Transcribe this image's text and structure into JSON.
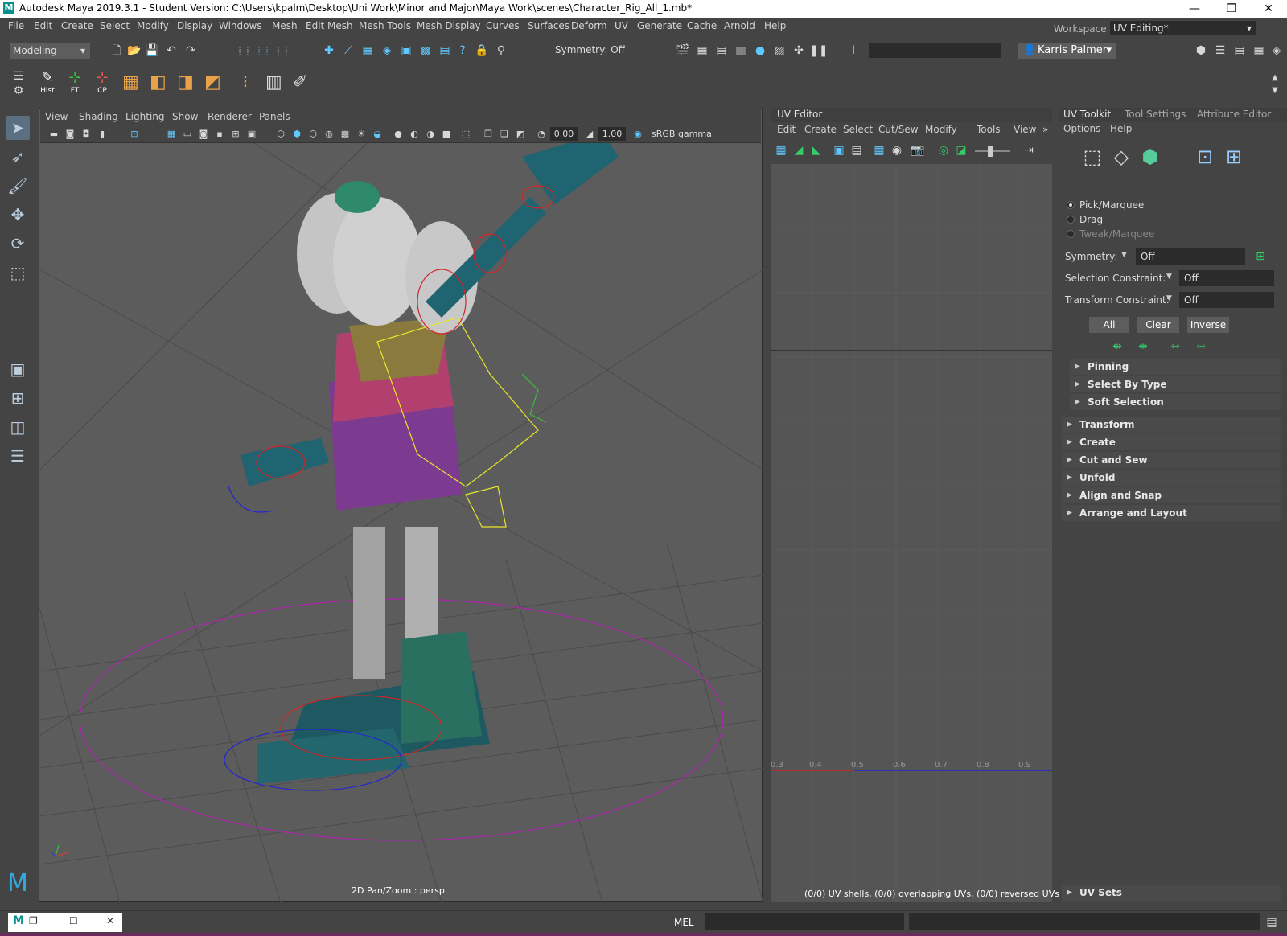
{
  "window": {
    "title": "Autodesk Maya 2019.3.1 - Student Version: C:\\Users\\kpalm\\Desktop\\Uni Work\\Minor and Major\\Maya Work\\scenes\\Character_Rig_All_1.mb*",
    "logo": "M",
    "minimize": "—",
    "restore": "❐",
    "close": "✕"
  },
  "menubar": {
    "items": [
      "File",
      "Edit",
      "Create",
      "Select",
      "Modify",
      "Display",
      "Windows",
      "Mesh",
      "Edit Mesh",
      "Mesh Tools",
      "Mesh Display",
      "Curves",
      "Surfaces",
      "Deform",
      "UV",
      "Generate",
      "Cache",
      "Arnold",
      "Help"
    ],
    "workspace_label": "Workspace :",
    "workspace_value": "UV Editing*"
  },
  "statusline": {
    "mode": "Modeling",
    "symmetry": "Symmetry: Off",
    "user": "Karris Palmer"
  },
  "shelf": {
    "buttons": [
      {
        "label": "Hist",
        "icon": "history-icon"
      },
      {
        "label": "FT",
        "icon": "freeze-transform-icon"
      },
      {
        "label": "CP",
        "icon": "center-pivot-icon"
      }
    ]
  },
  "viewport": {
    "menu": [
      "View",
      "Shading",
      "Lighting",
      "Show",
      "Renderer",
      "Panels"
    ],
    "exposure": "0.00",
    "gamma": "1.00",
    "color_space": "sRGB gamma",
    "status": "2D Pan/Zoom : persp"
  },
  "uv_editor": {
    "title": "UV Editor",
    "menu": [
      "Edit",
      "Create",
      "Select",
      "Cut/Sew",
      "Modify",
      "Tools",
      "View"
    ],
    "ticks": [
      "0.3",
      "0.4",
      "0.5",
      "0.6",
      "0.7",
      "0.8",
      "0.9"
    ],
    "status": "(0/0) UV shells, (0/0) overlapping UVs, (0/0) reversed UVs"
  },
  "uv_toolkit": {
    "tabs": [
      "UV Toolkit",
      "Tool Settings",
      "Attribute Editor"
    ],
    "menu": [
      "Options",
      "Help"
    ],
    "modes": [
      "Pick/Marquee",
      "Drag",
      "Tweak/Marquee"
    ],
    "symmetry_label": "Symmetry:",
    "symmetry_value": "Off",
    "selection_constraint_label": "Selection Constraint:",
    "selection_constraint_value": "Off",
    "transform_constraint_label": "Transform Constraint:",
    "transform_constraint_value": "Off",
    "buttons": [
      "All",
      "Clear",
      "Inverse"
    ],
    "sub_sections": [
      "Pinning",
      "Select By Type",
      "Soft Selection"
    ],
    "sections": [
      "Transform",
      "Create",
      "Cut and Sew",
      "Unfold",
      "Align and Snap",
      "Arrange and Layout"
    ],
    "uv_sets": "UV Sets"
  },
  "bottombar": {
    "mel_label": "MEL"
  },
  "colors": {
    "bg": "#444444",
    "viewport": "#5c5c5c",
    "accent": "#5ec8ff"
  }
}
